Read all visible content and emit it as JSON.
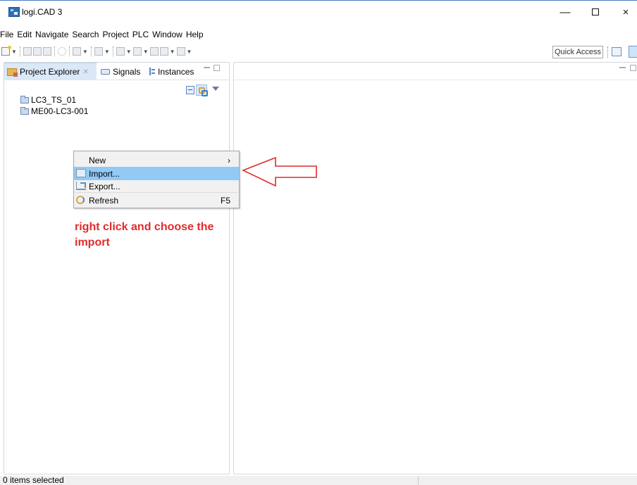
{
  "window": {
    "title": "logi.CAD 3",
    "controls": {
      "minimize": "—",
      "close": "×"
    }
  },
  "menubar": [
    "File",
    "Edit",
    "Navigate",
    "Search",
    "Project",
    "PLC",
    "Window",
    "Help"
  ],
  "toolbar": {
    "quick_access": "Quick Access"
  },
  "left_panel": {
    "tabs": [
      {
        "label": "Project Explorer",
        "icon": "project-explorer-icon",
        "active": true
      },
      {
        "label": "Signals",
        "icon": "signals-icon",
        "active": false
      },
      {
        "label": "Instances",
        "icon": "instances-icon",
        "active": false
      }
    ],
    "tree": [
      {
        "label": "LC3_TS_01",
        "icon": "folder-icon"
      },
      {
        "label": "ME00-LC3-001",
        "icon": "folder-icon"
      }
    ]
  },
  "context_menu": {
    "items": [
      {
        "label": "New",
        "accessory": "›"
      },
      {
        "label": "Import...",
        "highlighted": true,
        "icon": "import-icon"
      },
      {
        "label": "Export...",
        "icon": "export-icon"
      },
      {
        "label": "Refresh",
        "accessory": "F5",
        "icon": "refresh-icon"
      }
    ]
  },
  "annotation": {
    "text": "right click and choose the import",
    "color": "#e12b2b"
  },
  "statusbar": {
    "text": "0 items selected"
  },
  "colors": {
    "accent_highlight": "#91c9f7",
    "active_tab": "#dae8f7",
    "arrow": "#e12b2b"
  }
}
